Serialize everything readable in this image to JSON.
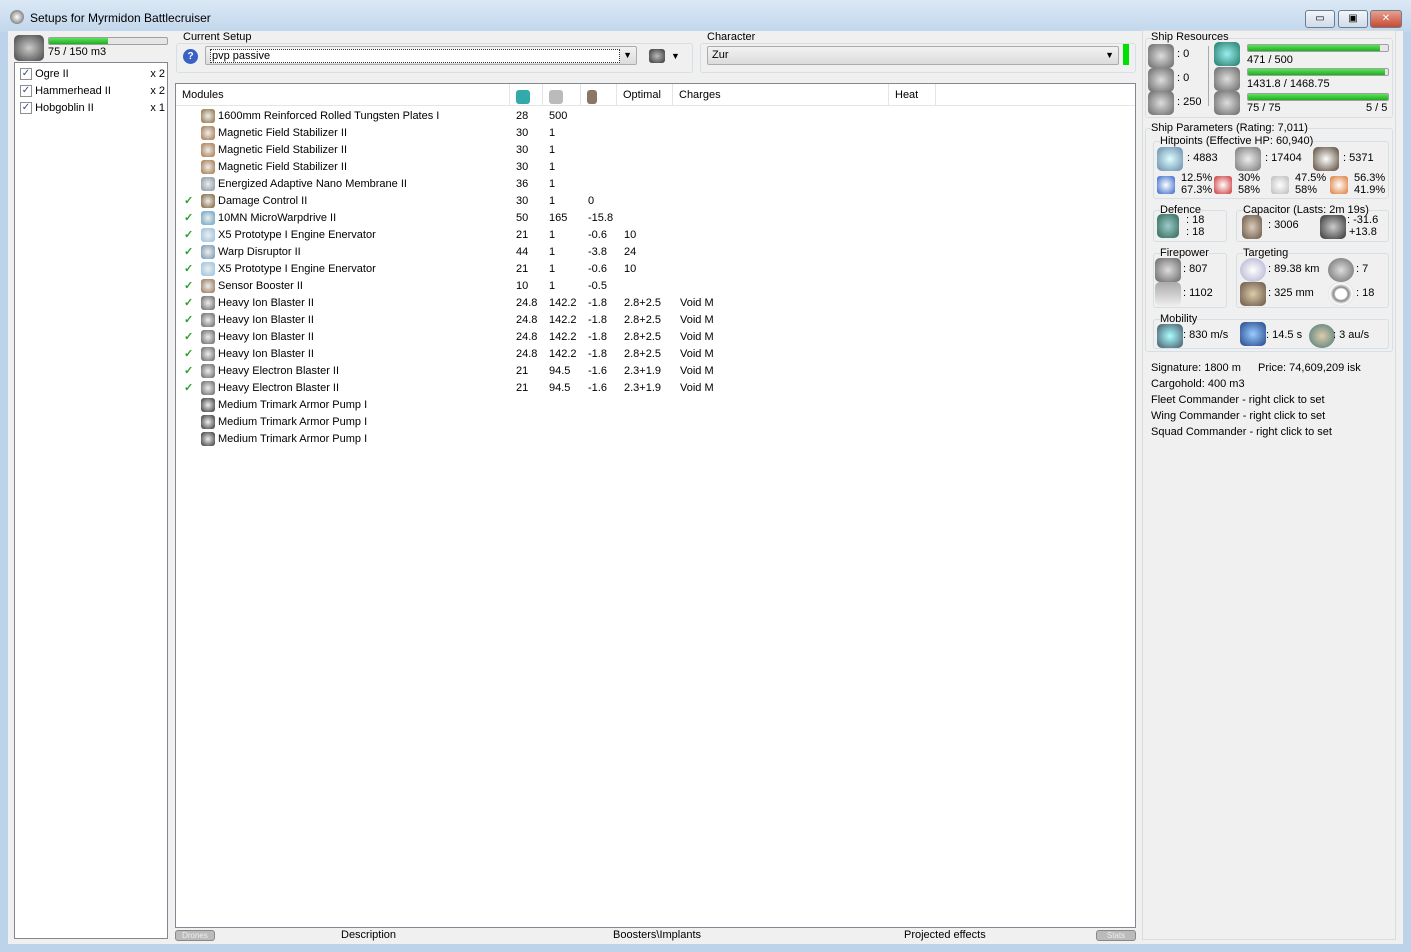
{
  "window": {
    "title": "Setups for Myrmidon Battlecruiser",
    "min": "▭",
    "max": "▣",
    "close": "✕"
  },
  "drones": {
    "bay": "75 / 150 m3",
    "bay_fraction": 0.5,
    "items": [
      {
        "name": "Ogre II",
        "count": "x 2",
        "checked": true
      },
      {
        "name": "Hammerhead II",
        "count": "x 2",
        "checked": true
      },
      {
        "name": "Hobgoblin II",
        "count": "x 1",
        "checked": true
      }
    ]
  },
  "setup": {
    "label": "Current Setup",
    "value": "pvp passive"
  },
  "character": {
    "label": "Character",
    "value": "Zur"
  },
  "modules": {
    "headers": [
      "Modules",
      "",
      "",
      "",
      "Optimal",
      "Charges",
      "Heat"
    ],
    "rows": [
      {
        "on": false,
        "name": "1600mm Reinforced Rolled Tungsten Plates I",
        "c1": "28",
        "c2": "500",
        "c3": "",
        "opt": "",
        "charge": "",
        "color": "#8a6a3a"
      },
      {
        "on": false,
        "name": "Magnetic Field Stabilizer II",
        "c1": "30",
        "c2": "1",
        "c3": "",
        "opt": "",
        "charge": "",
        "color": "#a07040"
      },
      {
        "on": false,
        "name": "Magnetic Field Stabilizer II",
        "c1": "30",
        "c2": "1",
        "c3": "",
        "opt": "",
        "charge": "",
        "color": "#a07040"
      },
      {
        "on": false,
        "name": "Magnetic Field Stabilizer II",
        "c1": "30",
        "c2": "1",
        "c3": "",
        "opt": "",
        "charge": "",
        "color": "#a07040"
      },
      {
        "on": false,
        "name": "Energized Adaptive Nano Membrane II",
        "c1": "36",
        "c2": "1",
        "c3": "",
        "opt": "",
        "charge": "",
        "color": "#8090a0"
      },
      {
        "on": true,
        "name": "Damage Control II",
        "c1": "30",
        "c2": "1",
        "c3": "0",
        "opt": "",
        "charge": "",
        "color": "#7a5a30"
      },
      {
        "on": true,
        "name": "10MN MicroWarpdrive II",
        "c1": "50",
        "c2": "165",
        "c3": "-15.8",
        "opt": "",
        "charge": "",
        "color": "#60a0c0"
      },
      {
        "on": true,
        "name": "X5 Prototype I Engine Enervator",
        "c1": "21",
        "c2": "1",
        "c3": "-0.6",
        "opt": "10",
        "charge": "",
        "color": "#90c0e0"
      },
      {
        "on": true,
        "name": "Warp Disruptor II",
        "c1": "44",
        "c2": "1",
        "c3": "-3.8",
        "opt": "24",
        "charge": "",
        "color": "#7090b0"
      },
      {
        "on": true,
        "name": "X5 Prototype I Engine Enervator",
        "c1": "21",
        "c2": "1",
        "c3": "-0.6",
        "opt": "10",
        "charge": "",
        "color": "#90c0e0"
      },
      {
        "on": true,
        "name": "Sensor Booster II",
        "c1": "10",
        "c2": "1",
        "c3": "-0.5",
        "opt": "",
        "charge": "",
        "color": "#907050"
      },
      {
        "on": true,
        "name": "Heavy Ion Blaster II",
        "c1": "24.8",
        "c2": "142.2",
        "c3": "-1.8",
        "opt": "2.8+2.5",
        "charge": "Void M",
        "color": "#606060"
      },
      {
        "on": true,
        "name": "Heavy Ion Blaster II",
        "c1": "24.8",
        "c2": "142.2",
        "c3": "-1.8",
        "opt": "2.8+2.5",
        "charge": "Void M",
        "color": "#606060"
      },
      {
        "on": true,
        "name": "Heavy Ion Blaster II",
        "c1": "24.8",
        "c2": "142.2",
        "c3": "-1.8",
        "opt": "2.8+2.5",
        "charge": "Void M",
        "color": "#606060"
      },
      {
        "on": true,
        "name": "Heavy Ion Blaster II",
        "c1": "24.8",
        "c2": "142.2",
        "c3": "-1.8",
        "opt": "2.8+2.5",
        "charge": "Void M",
        "color": "#606060"
      },
      {
        "on": true,
        "name": "Heavy Electron Blaster II",
        "c1": "21",
        "c2": "94.5",
        "c3": "-1.6",
        "opt": "2.3+1.9",
        "charge": "Void M",
        "color": "#606060"
      },
      {
        "on": true,
        "name": "Heavy Electron Blaster II",
        "c1": "21",
        "c2": "94.5",
        "c3": "-1.6",
        "opt": "2.3+1.9",
        "charge": "Void M",
        "color": "#606060"
      },
      {
        "on": false,
        "name": "Medium Trimark Armor Pump I",
        "c1": "",
        "c2": "",
        "c3": "",
        "opt": "",
        "charge": "",
        "color": "#303030"
      },
      {
        "on": false,
        "name": "Medium Trimark Armor Pump I",
        "c1": "",
        "c2": "",
        "c3": "",
        "opt": "",
        "charge": "",
        "color": "#303030"
      },
      {
        "on": false,
        "name": "Medium Trimark Armor Pump I",
        "c1": "",
        "c2": "",
        "c3": "",
        "opt": "",
        "charge": "",
        "color": "#303030"
      }
    ]
  },
  "tabs": {
    "drones": "Drones",
    "description": "Description",
    "boosters": "Boosters\\Implants",
    "projected": "Projected effects",
    "stats": "Stats"
  },
  "resources": {
    "title": "Ship Resources",
    "turrets": ": 0",
    "launchers": ": 0",
    "calibration": ": 250",
    "cpu": "471 / 500",
    "cpu_fraction": 0.942,
    "power": "1431.8 / 1468.75",
    "power_fraction": 0.975,
    "drone_bw": "75 / 75",
    "drones_active": "5 / 5",
    "bw_fraction": 1.0
  },
  "params": {
    "title": "Ship Parameters (Rating: 7,011)",
    "hp_title": "Hitpoints (Effective HP: 60,940)",
    "shield": ": 4883",
    "armor": ": 17404",
    "hull": ": 5371",
    "resists": [
      [
        "12.5%",
        "67.3%"
      ],
      [
        "30%",
        "58%"
      ],
      [
        "47.5%",
        "58%"
      ],
      [
        "56.3%",
        "41.9%"
      ]
    ],
    "defence": {
      "title": "Defence",
      "a": ": 18",
      "b": ": 18"
    },
    "capacitor": {
      "title": "Capacitor (Lasts: 2m 19s)",
      "amount": ": 3006",
      "use": ": -31.6",
      "regen": "+13.8"
    },
    "firepower": {
      "title": "Firepower",
      "a": ": 807",
      "b": ": 1102"
    },
    "targeting": {
      "title": "Targeting",
      "range": ": 89.38 km",
      "targets": ": 7",
      "res": ": 325 mm",
      "sensor": ": 18"
    },
    "mobility": {
      "title": "Mobility",
      "speed": ": 830 m/s",
      "align": ": 14.5 s",
      "warp": ": 3 au/s"
    },
    "signature": "Signature: 1800 m",
    "price": "Price: 74,609,209 isk",
    "cargo": "Cargohold: 400 m3",
    "fleet": "Fleet Commander - right click to set",
    "wing": "Wing Commander - right click to set",
    "squad": "Squad Commander - right click to set"
  }
}
